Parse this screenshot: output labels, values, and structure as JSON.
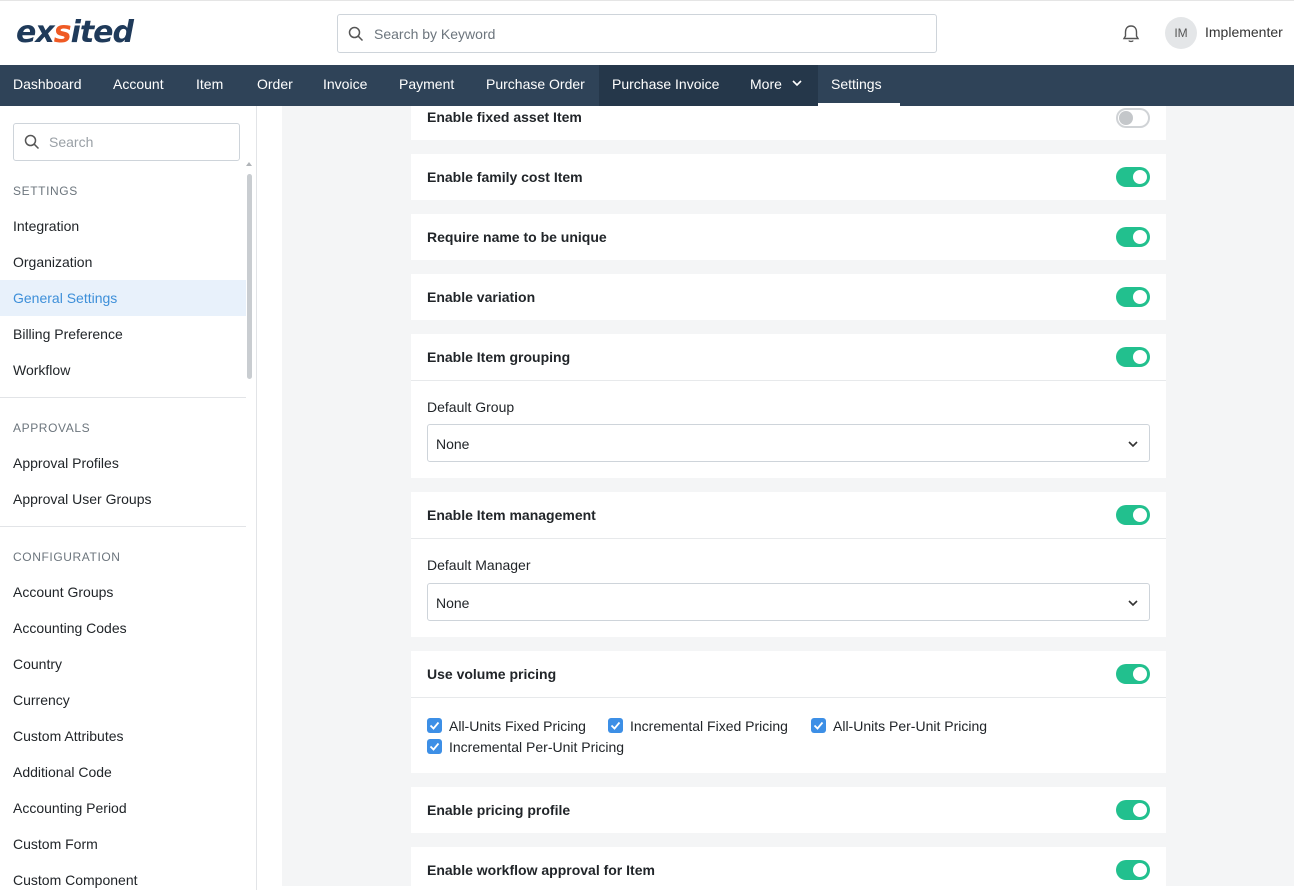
{
  "brand": {
    "logo_text_1": "ex",
    "logo_accent": "s",
    "logo_text_2": "ited"
  },
  "header": {
    "search_placeholder": "Search by Keyword",
    "avatar_initials": "IM",
    "user_name": "Implementer"
  },
  "nav": {
    "items": [
      "Dashboard",
      "Account",
      "Item",
      "Order",
      "Invoice",
      "Payment",
      "Purchase Order",
      "Purchase Invoice",
      "More",
      "Settings"
    ]
  },
  "sidebar": {
    "search_placeholder": "Search",
    "settings_label": "SETTINGS",
    "settings_items": [
      "Integration",
      "Organization",
      "General Settings",
      "Billing Preference",
      "Workflow"
    ],
    "approvals_label": "APPROVALS",
    "approvals_items": [
      "Approval Profiles",
      "Approval User Groups"
    ],
    "configuration_label": "CONFIGURATION",
    "configuration_items": [
      "Account Groups",
      "Accounting Codes",
      "Country",
      "Currency",
      "Custom Attributes",
      "Additional Code",
      "Accounting Period",
      "Custom Form",
      "Custom Component"
    ]
  },
  "settings": {
    "fixed_asset": {
      "title": "Enable fixed asset Item",
      "enabled": false
    },
    "family_cost": {
      "title": "Enable family cost Item",
      "enabled": true
    },
    "unique_name": {
      "title": "Require name to be unique",
      "enabled": true
    },
    "variation": {
      "title": "Enable variation",
      "enabled": true
    },
    "grouping": {
      "title": "Enable Item grouping",
      "enabled": true,
      "field_label": "Default Group",
      "value": "None"
    },
    "management": {
      "title": "Enable Item management",
      "enabled": true,
      "field_label": "Default Manager",
      "value": "None"
    },
    "volume_pricing": {
      "title": "Use volume pricing",
      "enabled": true,
      "options": [
        {
          "label": "All-Units Fixed Pricing",
          "checked": true
        },
        {
          "label": "Incremental Fixed Pricing",
          "checked": true
        },
        {
          "label": "All-Units Per-Unit Pricing",
          "checked": true
        },
        {
          "label": "Incremental Per-Unit Pricing",
          "checked": true
        }
      ]
    },
    "pricing_profile": {
      "title": "Enable pricing profile",
      "enabled": true
    },
    "workflow_approval": {
      "title": "Enable workflow approval for Item",
      "enabled": true
    }
  },
  "colors": {
    "nav_bg": "#2f4358",
    "toggle_on": "#22c08e",
    "accent_blue": "#3d8fd9",
    "logo_navy": "#1f3a5a",
    "logo_orange": "#ef5a24"
  }
}
